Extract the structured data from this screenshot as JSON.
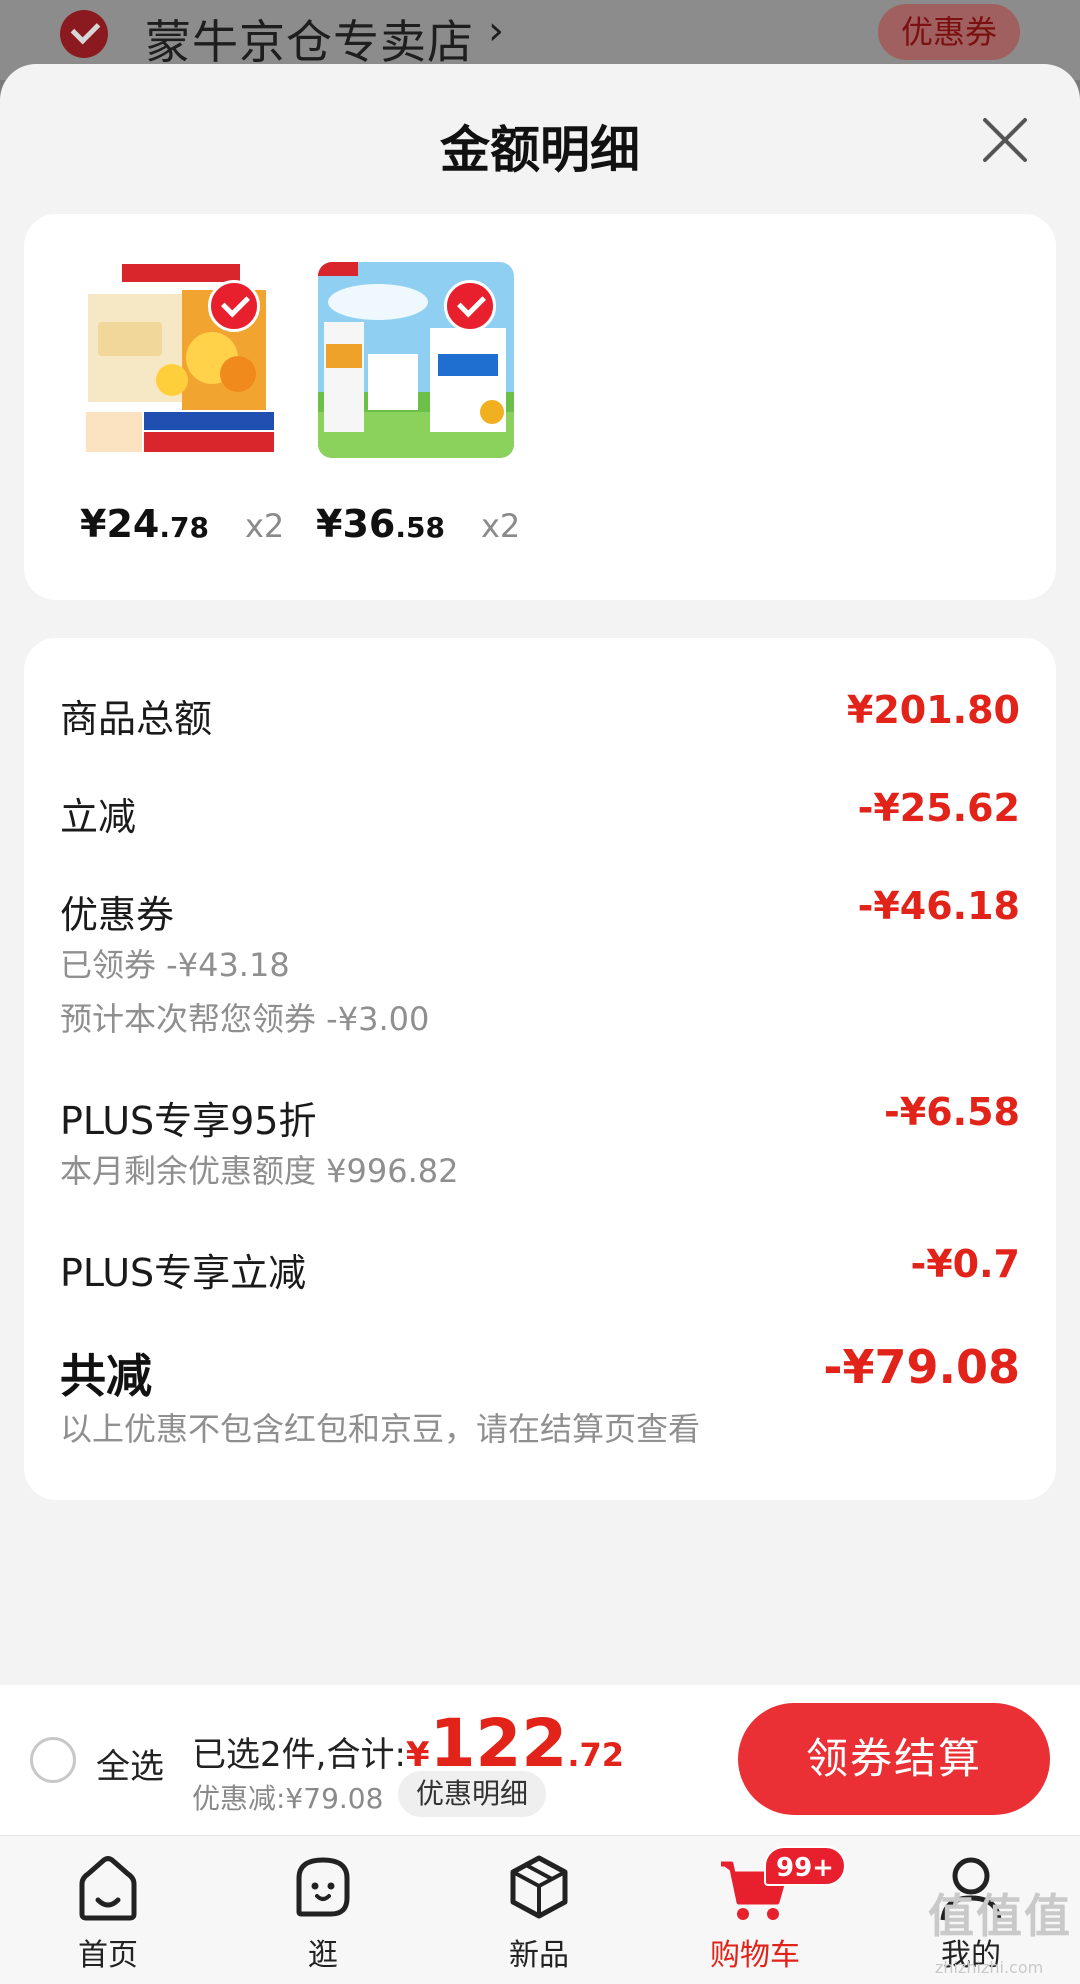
{
  "store_bar": {
    "store_name": "蒙牛京仓专卖店",
    "arrow": "›",
    "coupon_label": "优惠券"
  },
  "sheet": {
    "title": "金额明细",
    "close_icon": "close-icon"
  },
  "products": [
    {
      "price_int": "¥24",
      "price_dec": ".78",
      "qty": "x2",
      "selected": true
    },
    {
      "price_int": "¥36",
      "price_dec": ".58",
      "qty": "x2",
      "selected": true
    }
  ],
  "breakdown": {
    "goods_total": {
      "label": "商品总额",
      "amount": "¥201.80"
    },
    "instant_cut": {
      "label": "立减",
      "amount": "-¥25.62"
    },
    "coupon": {
      "label": "优惠券",
      "amount": "-¥46.18",
      "sub1": "已领券 -¥43.18",
      "sub2": "预计本次帮您领券 -¥3.00"
    },
    "plus_discount": {
      "label": "PLUS专享95折",
      "amount": "-¥6.58",
      "sub": "本月剩余优惠额度 ¥996.82"
    },
    "plus_cut": {
      "label": "PLUS专享立减",
      "amount": "-¥0.7"
    },
    "total": {
      "label": "共减",
      "amount": "-¥79.08",
      "note": "以上优惠不包含红包和京豆，请在结算页查看"
    }
  },
  "checkout": {
    "select_all": "全选",
    "summary_text": "已选2件,合计:",
    "currency": "¥",
    "total_int": "122",
    "total_dec": ".72",
    "discount_text": "优惠减:¥79.08",
    "detail_pill": "优惠明细",
    "pay_button": "领券结算"
  },
  "tabbar": {
    "tabs": [
      {
        "label": "首页",
        "icon": "home-icon"
      },
      {
        "label": "逛",
        "icon": "browse-face-icon"
      },
      {
        "label": "新品",
        "icon": "cube-icon"
      },
      {
        "label": "购物车",
        "icon": "cart-icon",
        "badge": "99+"
      },
      {
        "label": "我的",
        "icon": "profile-icon"
      }
    ]
  },
  "watermark": {
    "main": "值值值",
    "sub": "zhizhizhi.com"
  },
  "colors": {
    "accent_red": "#e2231a",
    "button_red": "#ea2f35",
    "sheet_bg": "#f3f3f3"
  }
}
